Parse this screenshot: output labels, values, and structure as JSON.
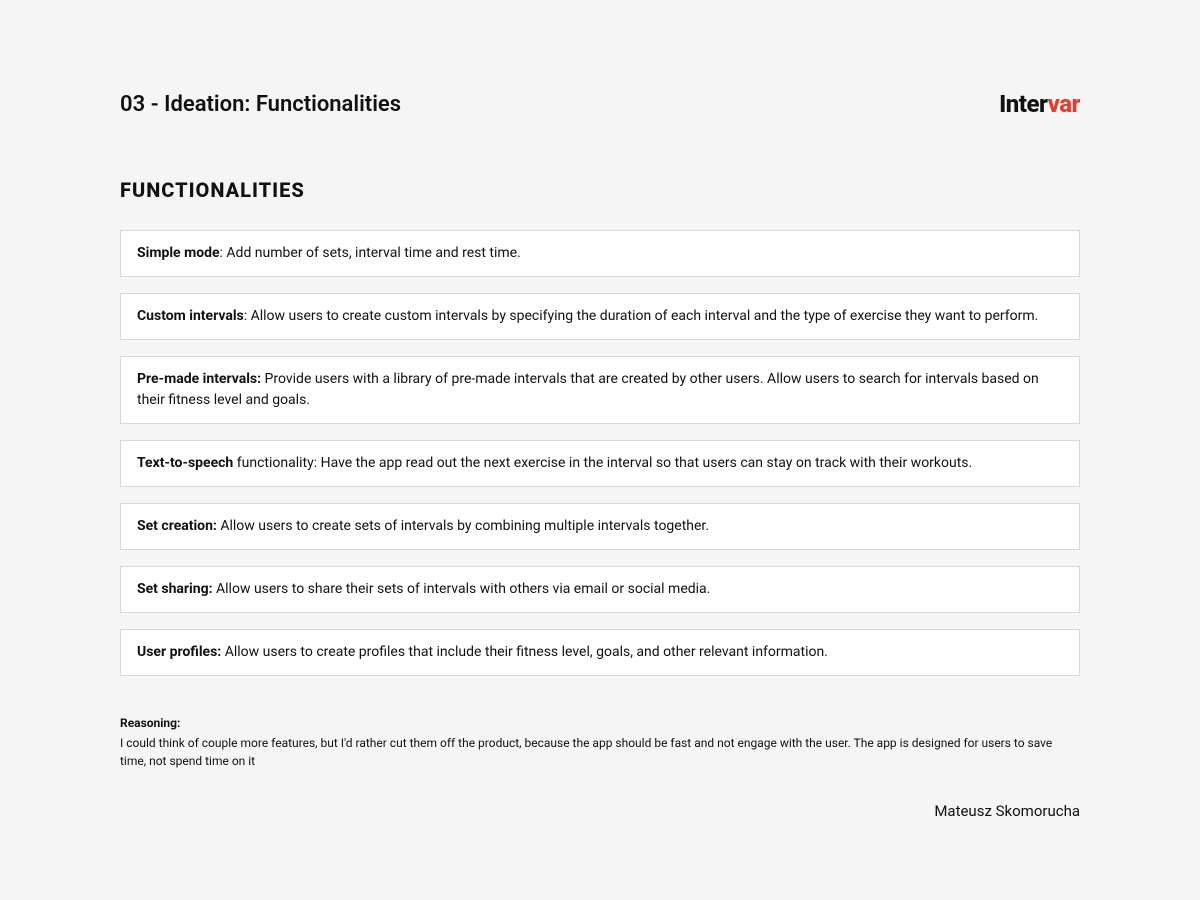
{
  "header": {
    "title": "03 - Ideation: Functionalities",
    "logo_part1": "Inter",
    "logo_part2": "var"
  },
  "section_heading": "FUNCTIONALITIES",
  "functionalities": [
    {
      "bold": "Simple mode",
      "rest": ": Add number of sets, interval time and rest time."
    },
    {
      "bold": "Custom intervals",
      "rest": ": Allow users to create custom intervals by specifying the duration of each interval and the type of exercise they want to perform."
    },
    {
      "bold": "Pre-made intervals:",
      "rest": " Provide users with a library of pre-made intervals that are created by other users. Allow users to search for intervals based on their fitness level and goals."
    },
    {
      "bold": "Text-to-speech",
      "rest": " functionality: Have the app read out the next exercise in the interval so that users can stay on track with their workouts."
    },
    {
      "bold": "Set creation:",
      "rest": " Allow users to create sets of intervals by combining multiple intervals together."
    },
    {
      "bold": "Set sharing:",
      "rest": " Allow users to share their sets of intervals with others via email or social media."
    },
    {
      "bold": "User profiles:",
      "rest": " Allow users to create profiles that include their fitness level, goals, and other relevant information."
    }
  ],
  "reasoning": {
    "label": "Reasoning:",
    "body": "I could think of couple more features, but I'd rather cut them off the product, because the app should be fast and not engage with the user. The app is designed for users to save time, not spend time on it"
  },
  "author": "Mateusz Skomorucha"
}
